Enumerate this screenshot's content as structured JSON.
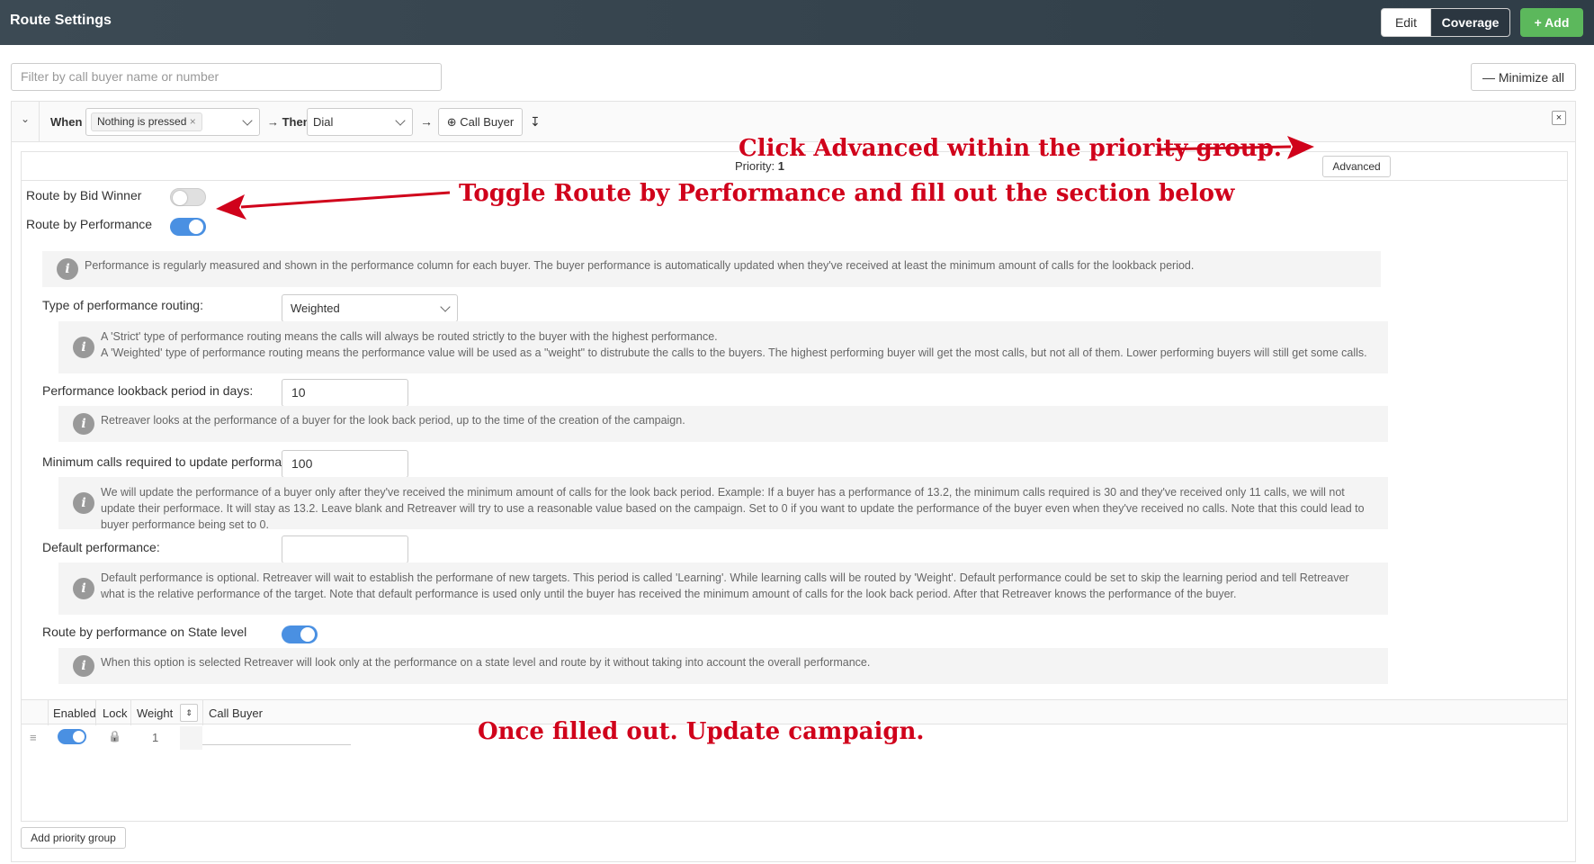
{
  "header": {
    "title": "Route Settings",
    "edit_label": "Edit",
    "coverage_label": "Coverage",
    "add_label": "+ Add"
  },
  "filter": {
    "placeholder": "Filter by call buyer name or number",
    "minimize_label": "— Minimize all"
  },
  "rule": {
    "when_label": "When",
    "when_value": "Nothing is pressed",
    "then_label": "→ Then",
    "then_value": "Dial",
    "arrow": "→",
    "call_buyer_label": "⊕ Call Buyer",
    "sort_icon": "↧",
    "close": "×"
  },
  "group": {
    "priority_label": "Priority:",
    "priority_value": "1",
    "advanced_label": "Advanced",
    "route_by_bid_winner": {
      "label": "Route by Bid Winner",
      "enabled": false
    },
    "route_by_performance": {
      "label": "Route by Performance",
      "enabled": true
    },
    "perf_info": "Performance is regularly measured and shown in the performance column for each buyer. The buyer performance is automatically updated when they've received at least the minimum amount of calls for the lookback period.",
    "type_label": "Type of performance routing:",
    "type_value": "Weighted",
    "type_info_1": "A 'Strict' type of performance routing means the calls will always be routed strictly to the buyer with the highest performance.",
    "type_info_2": "A 'Weighted' type of performance routing means the performance value will be used as a \"weight\" to distrubute the calls to the buyers. The highest performing buyer will get the most calls, but not all of them. Lower performing buyers will still get some calls.",
    "lookback_label": "Performance lookback period in days:",
    "lookback_value": "10",
    "lookback_info": "Retreaver looks at the performance of a buyer for the look back period, up to the time of the creation of the campaign.",
    "min_calls_label": "Minimum calls required to update performace:",
    "min_calls_value": "100",
    "min_calls_info": "We will update the performance of a buyer only after they've received the minimum amount of calls for the look back period. Example: If a buyer has a performance of 13.2, the minimum calls required is 30 and they've received only 11 calls, we will not update their performace. It will stay as 13.2. Leave blank and Retreaver will try to use a reasonable value based on the campaign. Set to 0 if you want to update the performance of the buyer even when they've received no calls. Note that this could lead to buyer performance being set to 0.",
    "default_label": "Default performance:",
    "default_value": "",
    "default_info": "Default performance is optional. Retreaver will wait to establish the performane of new targets. This period is called 'Learning'. While learning calls will be routed by 'Weight'. Default performance could be set to skip the learning period and tell Retreaver what is the relative performance of the target. Note that default performance is used only until the buyer has received the minimum amount of calls for the look back period. After that Retreaver knows the performance of the buyer.",
    "state_label": "Route by performance on State level",
    "state_enabled": true,
    "state_info": "When this option is selected Retreaver will look only at the performance on a state level and route by it without taking into account the overall performance.",
    "info_glyph": "i"
  },
  "table": {
    "columns": [
      "Enabled",
      "Lock",
      "Weight",
      "Call Buyer"
    ],
    "sort_glyph": "⇕",
    "rows": [
      {
        "drag": "≡",
        "enabled": true,
        "lock": "🔒",
        "weight": "1",
        "call_buyer": ""
      }
    ]
  },
  "add_priority_group_label": "Add priority group",
  "annotations": {
    "advanced": "Click Advanced within the priority group.",
    "toggle": "Toggle Route by Performance and fill out the section below",
    "update": "Once filled out. Update campaign.",
    "color": "#d0021b"
  }
}
